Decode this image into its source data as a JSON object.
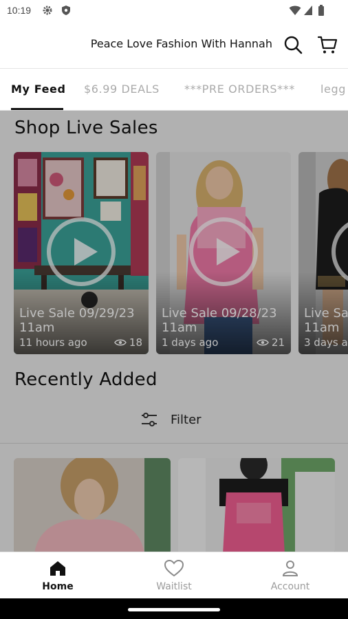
{
  "status_bar": {
    "time": "10:19"
  },
  "header": {
    "store_name": "Peace Love Fashion With Hannah"
  },
  "tabs": [
    {
      "label": "My Feed",
      "active": true
    },
    {
      "label": "$6.99 DEALS",
      "active": false
    },
    {
      "label": "***PRE ORDERS***",
      "active": false
    },
    {
      "label": "legg",
      "active": false
    }
  ],
  "live_sales": {
    "title": "Shop Live Sales",
    "items": [
      {
        "title_line1": "Live Sale 09/29/23",
        "title_line2": "11am",
        "ago": "11 hours ago",
        "views": "18"
      },
      {
        "title_line1": "Live Sale 09/28/23",
        "title_line2": "11am",
        "ago": "1 days ago",
        "views": "21"
      },
      {
        "title_line1": "Live Sa",
        "title_line2": "11am",
        "ago": "3 days a",
        "views": ""
      }
    ]
  },
  "recent": {
    "title": "Recently Added",
    "filter_label": "Filter"
  },
  "bottom_nav": {
    "items": [
      {
        "label": "Home",
        "icon": "home-icon",
        "active": true
      },
      {
        "label": "Waitlist",
        "icon": "heart-icon",
        "active": false
      },
      {
        "label": "Account",
        "icon": "person-icon",
        "active": false
      }
    ]
  },
  "colors": {
    "accent": "#111111",
    "inactive": "#9a9a9a",
    "content_bg": "#ececec"
  }
}
